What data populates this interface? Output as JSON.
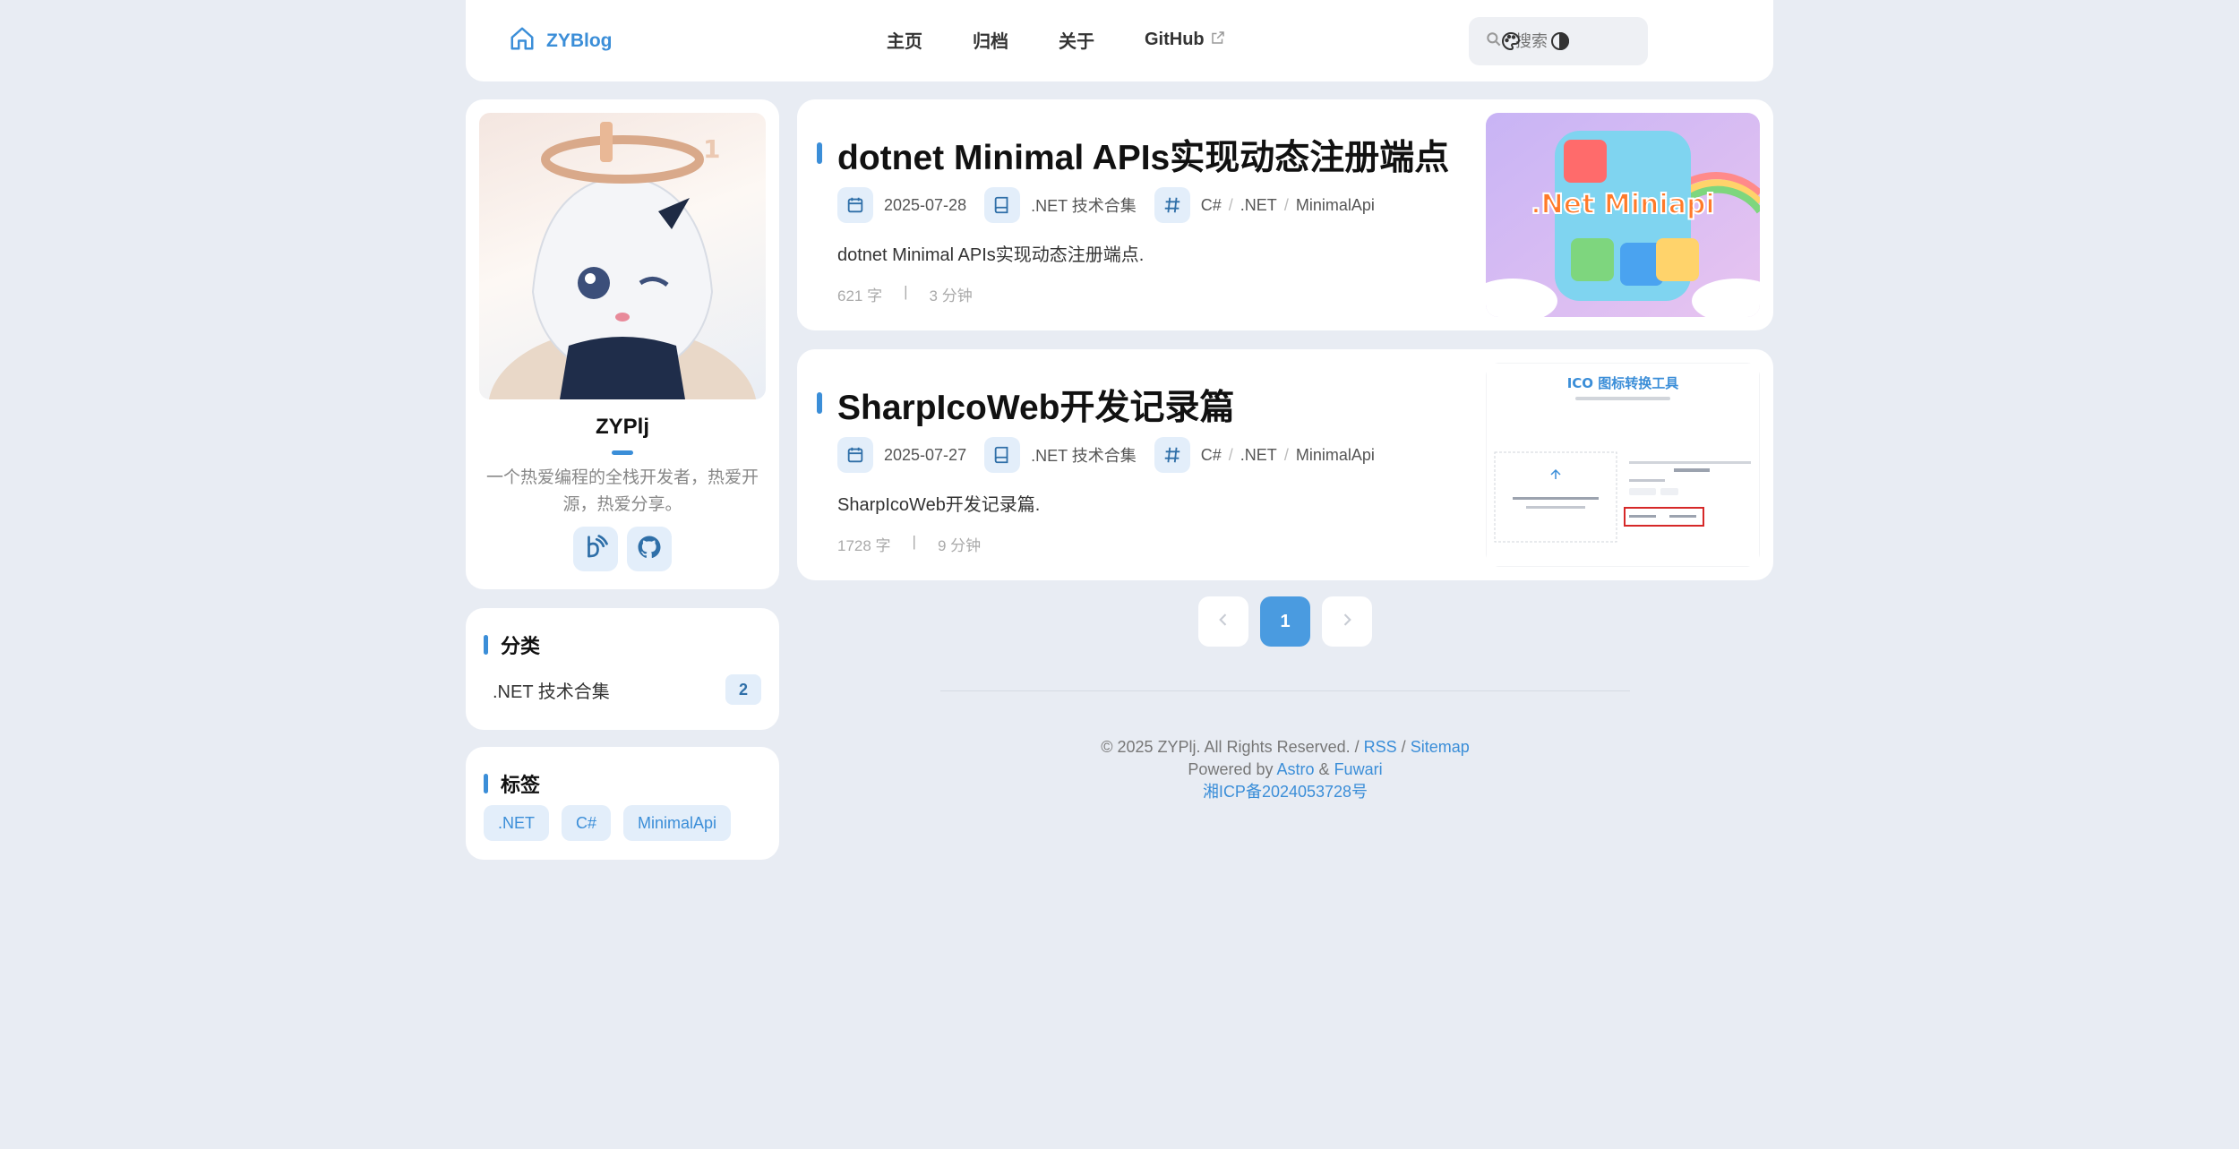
{
  "navbar": {
    "brand": "ZYBlog",
    "links": [
      "主页",
      "归档",
      "关于",
      "GitHub"
    ],
    "search_placeholder": "搜索"
  },
  "profile": {
    "name": "ZYPlj",
    "bio": "一个热爱编程的全栈开发者，热爱开源，热爱分享。"
  },
  "categories": {
    "title": "分类",
    "items": [
      {
        "label": ".NET 技术合集",
        "count": "2"
      }
    ]
  },
  "tags": {
    "title": "标签",
    "items": [
      ".NET",
      "C#",
      "MinimalApi"
    ]
  },
  "posts": [
    {
      "title": "dotnet Minimal APIs实现动态注册端点",
      "date": "2025-07-28",
      "category": ".NET 技术合集",
      "tags": [
        "C#",
        ".NET",
        "MinimalApi"
      ],
      "description": "dotnet Minimal APIs实现动态注册端点.",
      "words": "621 字",
      "read_time": "3 分钟",
      "thumb_text": ".Net Miniapi"
    },
    {
      "title": "SharpIcoWeb开发记录篇",
      "date": "2025-07-27",
      "category": ".NET 技术合集",
      "tags": [
        "C#",
        ".NET",
        "MinimalApi"
      ],
      "description": "SharpIcoWeb开发记录篇.",
      "words": "1728 字",
      "read_time": "9 分钟",
      "thumb_title": "ICO 图标转换工具"
    }
  ],
  "pagination": {
    "current": "1"
  },
  "footer": {
    "copyright": "© 2025 ZYPlj. All Rights Reserved. /",
    "rss": "RSS",
    "slash": "/",
    "sitemap": "Sitemap",
    "powered_by": "Powered by",
    "astro": "Astro",
    "amp": "&",
    "fuwari": "Fuwari",
    "icp": "湘ICP备2024053728号"
  },
  "colors": {
    "accent": "#3b8ed8",
    "background": "#e8ecf3"
  }
}
